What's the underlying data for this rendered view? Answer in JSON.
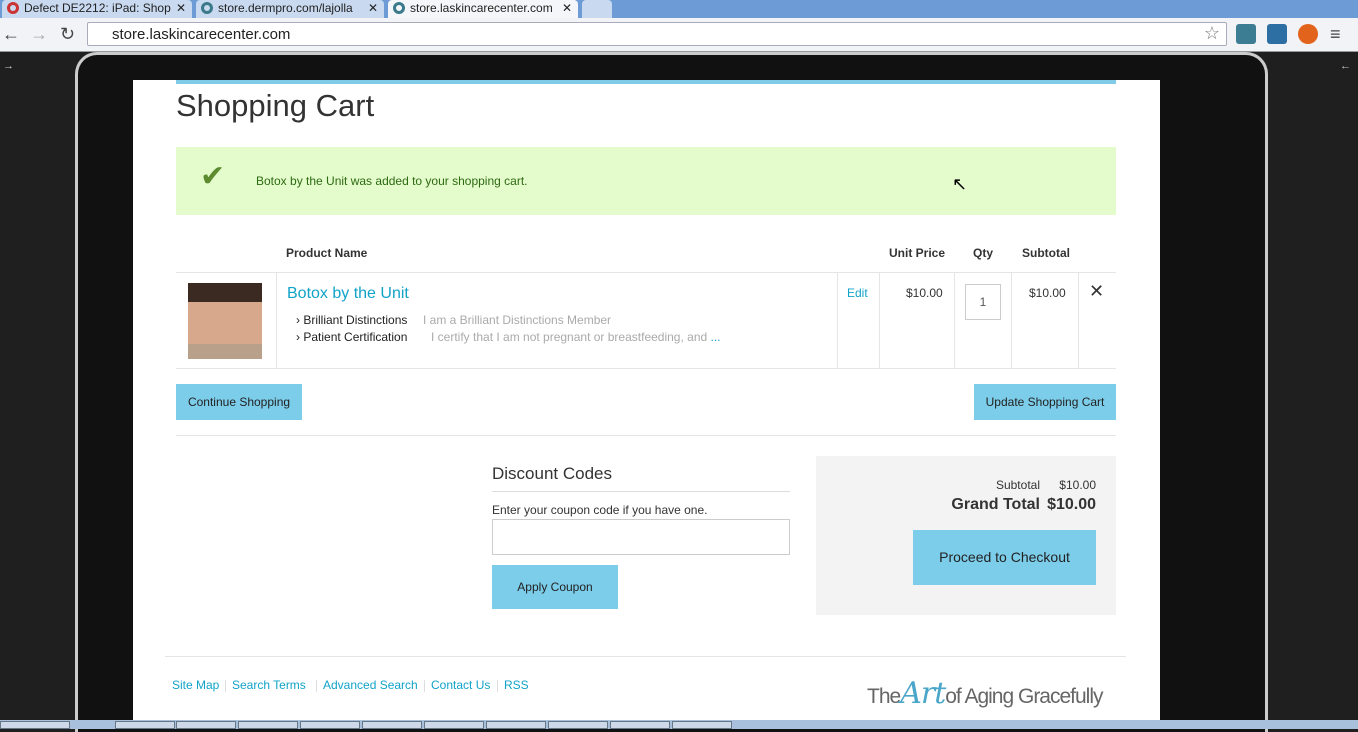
{
  "browser": {
    "tabs": [
      {
        "title": "Defect DE2212: iPad: Shop"
      },
      {
        "title": "store.dermpro.com/lajolla"
      },
      {
        "title": "store.laskincarecenter.com"
      }
    ],
    "url": "store.laskincarecenter.com"
  },
  "page": {
    "title": "Shopping Cart",
    "success_message": "Botox by the Unit was added to your shopping cart.",
    "table": {
      "headers": {
        "product": "Product Name",
        "unit_price": "Unit Price",
        "qty": "Qty",
        "subtotal": "Subtotal"
      },
      "items": [
        {
          "name": "Botox by the Unit",
          "options": [
            {
              "label": "Brilliant Distinctions",
              "value": "I am a Brilliant Distinctions Member"
            },
            {
              "label": "Patient Certification",
              "value": "I certify that I am not pregnant or breastfeeding, and",
              "more": "..."
            }
          ],
          "edit": "Edit",
          "unit_price": "$10.00",
          "qty": "1",
          "subtotal": "$10.00"
        }
      ]
    },
    "continue_label": "Continue Shopping",
    "update_label": "Update Shopping Cart",
    "discount": {
      "title": "Discount Codes",
      "label": "Enter your coupon code if you have one.",
      "value": "",
      "apply_label": "Apply Coupon"
    },
    "totals": {
      "subtotal_label": "Subtotal",
      "subtotal": "$10.00",
      "grand_label": "Grand Total",
      "grand": "$10.00",
      "checkout_label": "Proceed to Checkout"
    },
    "footer": {
      "links": [
        "Site Map",
        "Search Terms",
        "Advanced Search",
        "Contact Us",
        "RSS"
      ],
      "logo": {
        "pre": "The",
        "art": "Art",
        "post": "of Aging Gracefully"
      }
    }
  }
}
